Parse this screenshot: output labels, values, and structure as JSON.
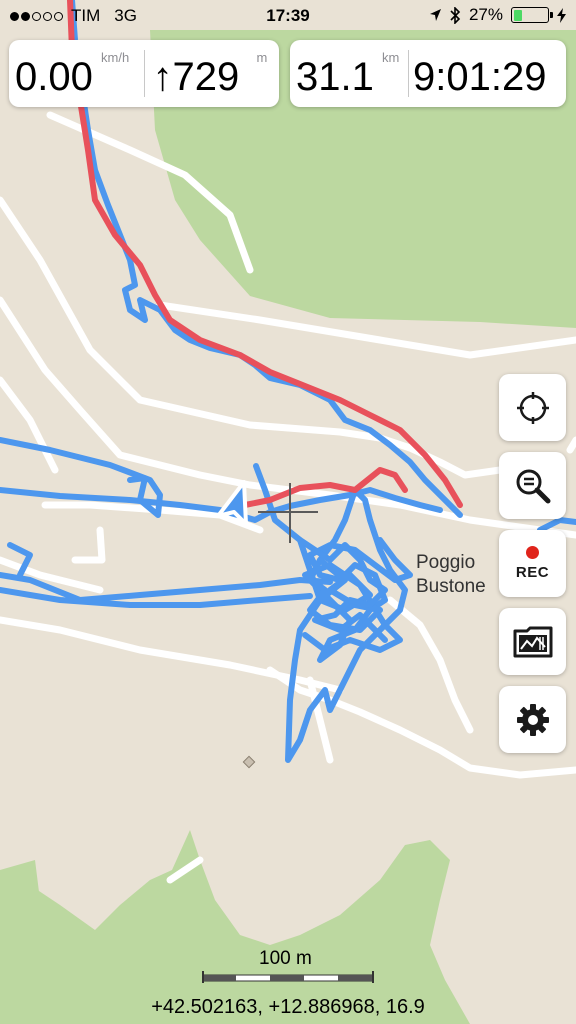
{
  "status": {
    "carrier": "TIM",
    "network": "3G",
    "time": "17:39",
    "battery_text": "27%",
    "battery_level": 0.27,
    "signal_bars": 2
  },
  "readouts": {
    "speed": {
      "value": "0.00",
      "unit": "km/h"
    },
    "altitude": {
      "value": "↑729",
      "unit": "m"
    },
    "distance": {
      "value": "31.1",
      "unit": "km"
    },
    "duration": {
      "value": "9:01:29"
    }
  },
  "controls": {
    "rec_label": "REC"
  },
  "map": {
    "place_name_line1": "Poggio",
    "place_name_line2": "Bustone",
    "scale_label": "100 m",
    "coordinates": "+42.502163, +12.886968, 16.9"
  },
  "colors": {
    "land": "#e9e2d5",
    "forest": "#bcd8a0",
    "road": "#ffffff",
    "track_planned": "#e8515b",
    "track_recorded": "#4d97ee",
    "rec_dot": "#e0241b",
    "battery_fill": "#4cd964"
  },
  "icons": {
    "locate": "crosshair-locate-icon",
    "zoom": "zoom-out-magnifier-icon",
    "tracks": "tracks-folder-icon",
    "settings": "gear-icon",
    "location": "location-arrow-icon",
    "bluetooth": "bluetooth-icon"
  }
}
